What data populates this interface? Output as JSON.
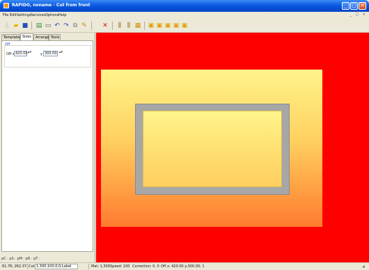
{
  "window": {
    "title": "RAPIDO, noname - Cut from front",
    "minimize": "_",
    "maximize": "□",
    "close": "✕"
  },
  "menu": {
    "items": [
      "File",
      "Edit",
      "Settings",
      "Services",
      "Options",
      "Help"
    ],
    "mdi_controls": "_ □ ✕"
  },
  "toolbar": {
    "icons": [
      "new-icon",
      "open-icon",
      "save-icon",
      "print-icon",
      "preview-icon",
      "undo-icon",
      "redo-icon",
      "copy-icon",
      "paste-icon",
      "delete-icon",
      "align-icon",
      "align2-icon",
      "cut-icon",
      "folder1-icon",
      "folder2-icon",
      "folder3-icon",
      "folder4-icon",
      "folder5-icon"
    ]
  },
  "panel": {
    "tabs": [
      "Templates",
      "Sizes",
      "Arrange",
      "Tools"
    ],
    "active_tab": "Sizes",
    "group_label": "Off",
    "off_x_label": "Off x",
    "off_x_value": "420.00",
    "y_label": "y",
    "y_value": "300.00",
    "bottom_controls": "pC · pS · pM · pR · pT ·"
  },
  "status": {
    "coords": "61.76; 262.37",
    "cut_label": "Cut",
    "cut_value": "1,300;100;0;0;Label",
    "mat": "Mat: 1,300",
    "speed": "Speed: 100",
    "correction": "Correction: 0, 0",
    "off": "Off x: 420.00 y:300.00; 1"
  },
  "colors": {
    "canvas": "#ff0000",
    "sheet_top": "#fff48a",
    "sheet_bottom": "#ff7a30",
    "frame": "#a7a7a7",
    "titlebar": "#0a5ae0"
  }
}
